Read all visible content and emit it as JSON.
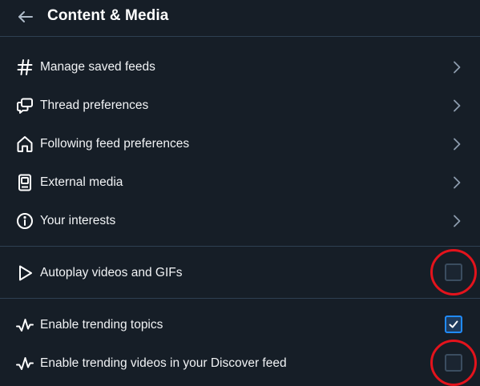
{
  "header": {
    "title": "Content & Media"
  },
  "nav_items": [
    {
      "label": "Manage saved feeds",
      "icon": "hash-icon"
    },
    {
      "label": "Thread preferences",
      "icon": "chat-bubbles-icon"
    },
    {
      "label": "Following feed preferences",
      "icon": "home-icon"
    },
    {
      "label": "External media",
      "icon": "media-player-icon"
    },
    {
      "label": "Your interests",
      "icon": "info-icon"
    }
  ],
  "toggles": [
    {
      "label": "Autoplay videos and GIFs",
      "icon": "play-icon",
      "checked": false,
      "highlighted": true
    },
    {
      "label": "Enable trending topics",
      "icon": "trending-icon",
      "checked": true,
      "highlighted": false
    },
    {
      "label": "Enable trending videos in your Discover feed",
      "icon": "trending-icon",
      "checked": false,
      "highlighted": true
    }
  ],
  "colors": {
    "background": "#161e27",
    "divider": "#2e4052",
    "accent": "#208bfe",
    "annotation": "#e3131c"
  }
}
